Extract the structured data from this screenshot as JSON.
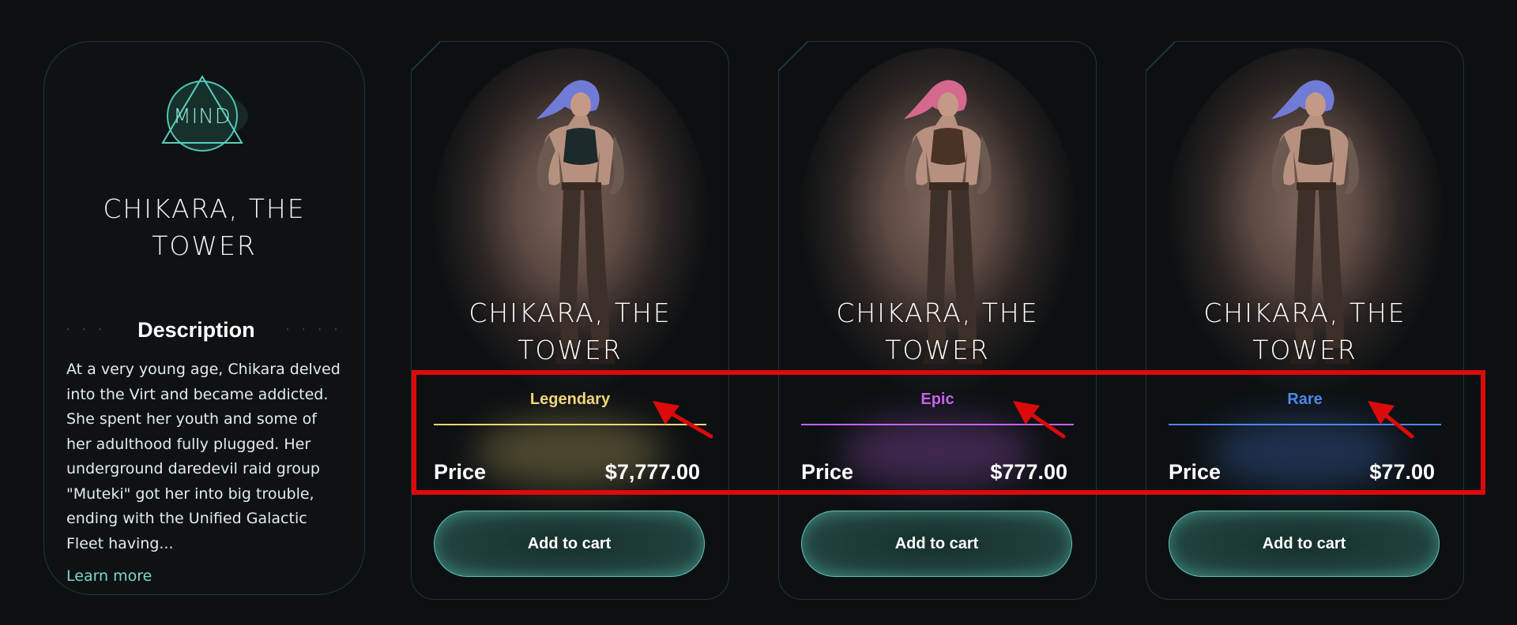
{
  "info_card": {
    "emblem_label": "MIND",
    "title": "CHIKARA, THE TOWER",
    "description_heading": "Description",
    "dots_left": "· · ·",
    "dots_right": "· · · ·",
    "description": "At a very young age, Chikara delved into the Virt and became addicted. She spent her youth and some of her adulthood fully plugged. Her underground daredevil raid group \"Muteki\" got her into big trouble, ending with the Unified Galactic Fleet having...",
    "learn_more": "Learn more"
  },
  "products": [
    {
      "title": "CHIKARA, THE TOWER",
      "rarity": "Legendary",
      "rarity_color": "#f3d57a",
      "price_label": "Price",
      "price": "$7,777.00",
      "button": "Add to cart",
      "hair_color": "#6f7bd6",
      "top_color": "#1c2a2c"
    },
    {
      "title": "CHIKARA, THE TOWER",
      "rarity": "Epic",
      "rarity_color": "#c463e8",
      "price_label": "Price",
      "price": "$777.00",
      "button": "Add to cart",
      "hair_color": "#d4688e",
      "top_color": "#4a3224"
    },
    {
      "title": "CHIKARA, THE TOWER",
      "rarity": "Rare",
      "rarity_color": "#4e86e8",
      "price_label": "Price",
      "price": "$77.00",
      "button": "Add to cart",
      "hair_color": "#6f7bd6",
      "top_color": "#3a3028"
    }
  ],
  "colors": {
    "accent": "#7fd6c6",
    "annotation": "#dc0a0a",
    "background": "#0d1012"
  }
}
